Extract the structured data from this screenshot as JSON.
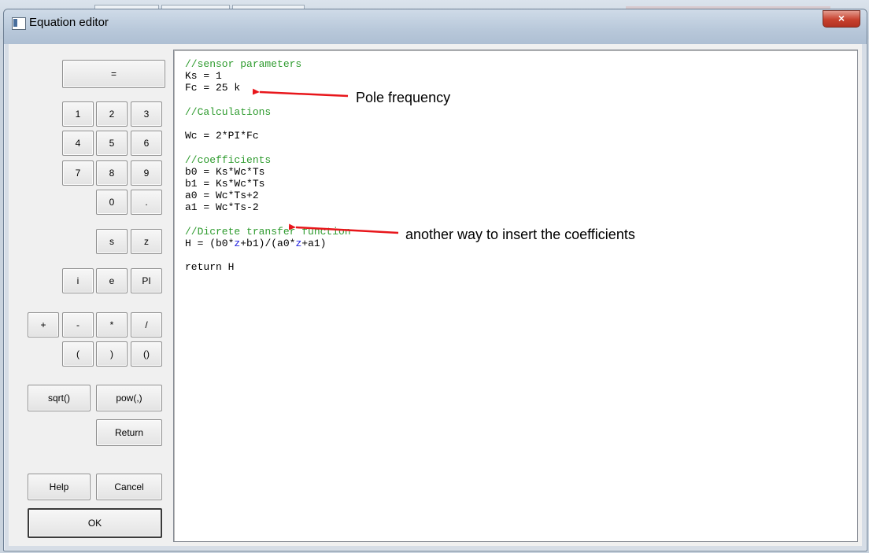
{
  "window": {
    "title": "Equation editor",
    "close_glyph": "×"
  },
  "keypad": {
    "equals": "=",
    "digits": [
      "1",
      "2",
      "3",
      "4",
      "5",
      "6",
      "7",
      "8",
      "9",
      "0",
      "."
    ],
    "vars": [
      "s",
      "z"
    ],
    "consts": [
      "i",
      "e",
      "PI"
    ],
    "ops": [
      "+",
      "-",
      "*",
      "/"
    ],
    "parens": [
      "(",
      ")",
      "()"
    ],
    "funcs": [
      "sqrt()",
      "pow(,)"
    ],
    "return_label": "Return",
    "help_label": "Help",
    "cancel_label": "Cancel",
    "ok_label": "OK"
  },
  "editor": {
    "lines": [
      {
        "t": "//sensor parameters",
        "c": "cm"
      },
      {
        "t": "Ks = 1"
      },
      {
        "t": "Fc = 25 k"
      },
      {
        "t": ""
      },
      {
        "t": "//Calculations",
        "c": "cm"
      },
      {
        "t": ""
      },
      {
        "t": "Wc = 2*PI*Fc"
      },
      {
        "t": ""
      },
      {
        "t": "//coefficients",
        "c": "cm"
      },
      {
        "t": "b0 = Ks*Wc*Ts"
      },
      {
        "t": "b1 = Ks*Wc*Ts"
      },
      {
        "t": "a0 = Wc*Ts+2"
      },
      {
        "t": "a1 = Wc*Ts-2"
      },
      {
        "t": ""
      },
      {
        "t": "//Dicrete transfer function",
        "c": "cm"
      },
      {
        "t": "H = (b0*z+b1)/(a0*z+a1)",
        "z": true
      },
      {
        "t": ""
      },
      {
        "t": "return H"
      }
    ]
  },
  "annotations": {
    "pole": "Pole frequency",
    "coeffs": "another way to insert the coefficients",
    "arrow_color": "#e8161b"
  }
}
